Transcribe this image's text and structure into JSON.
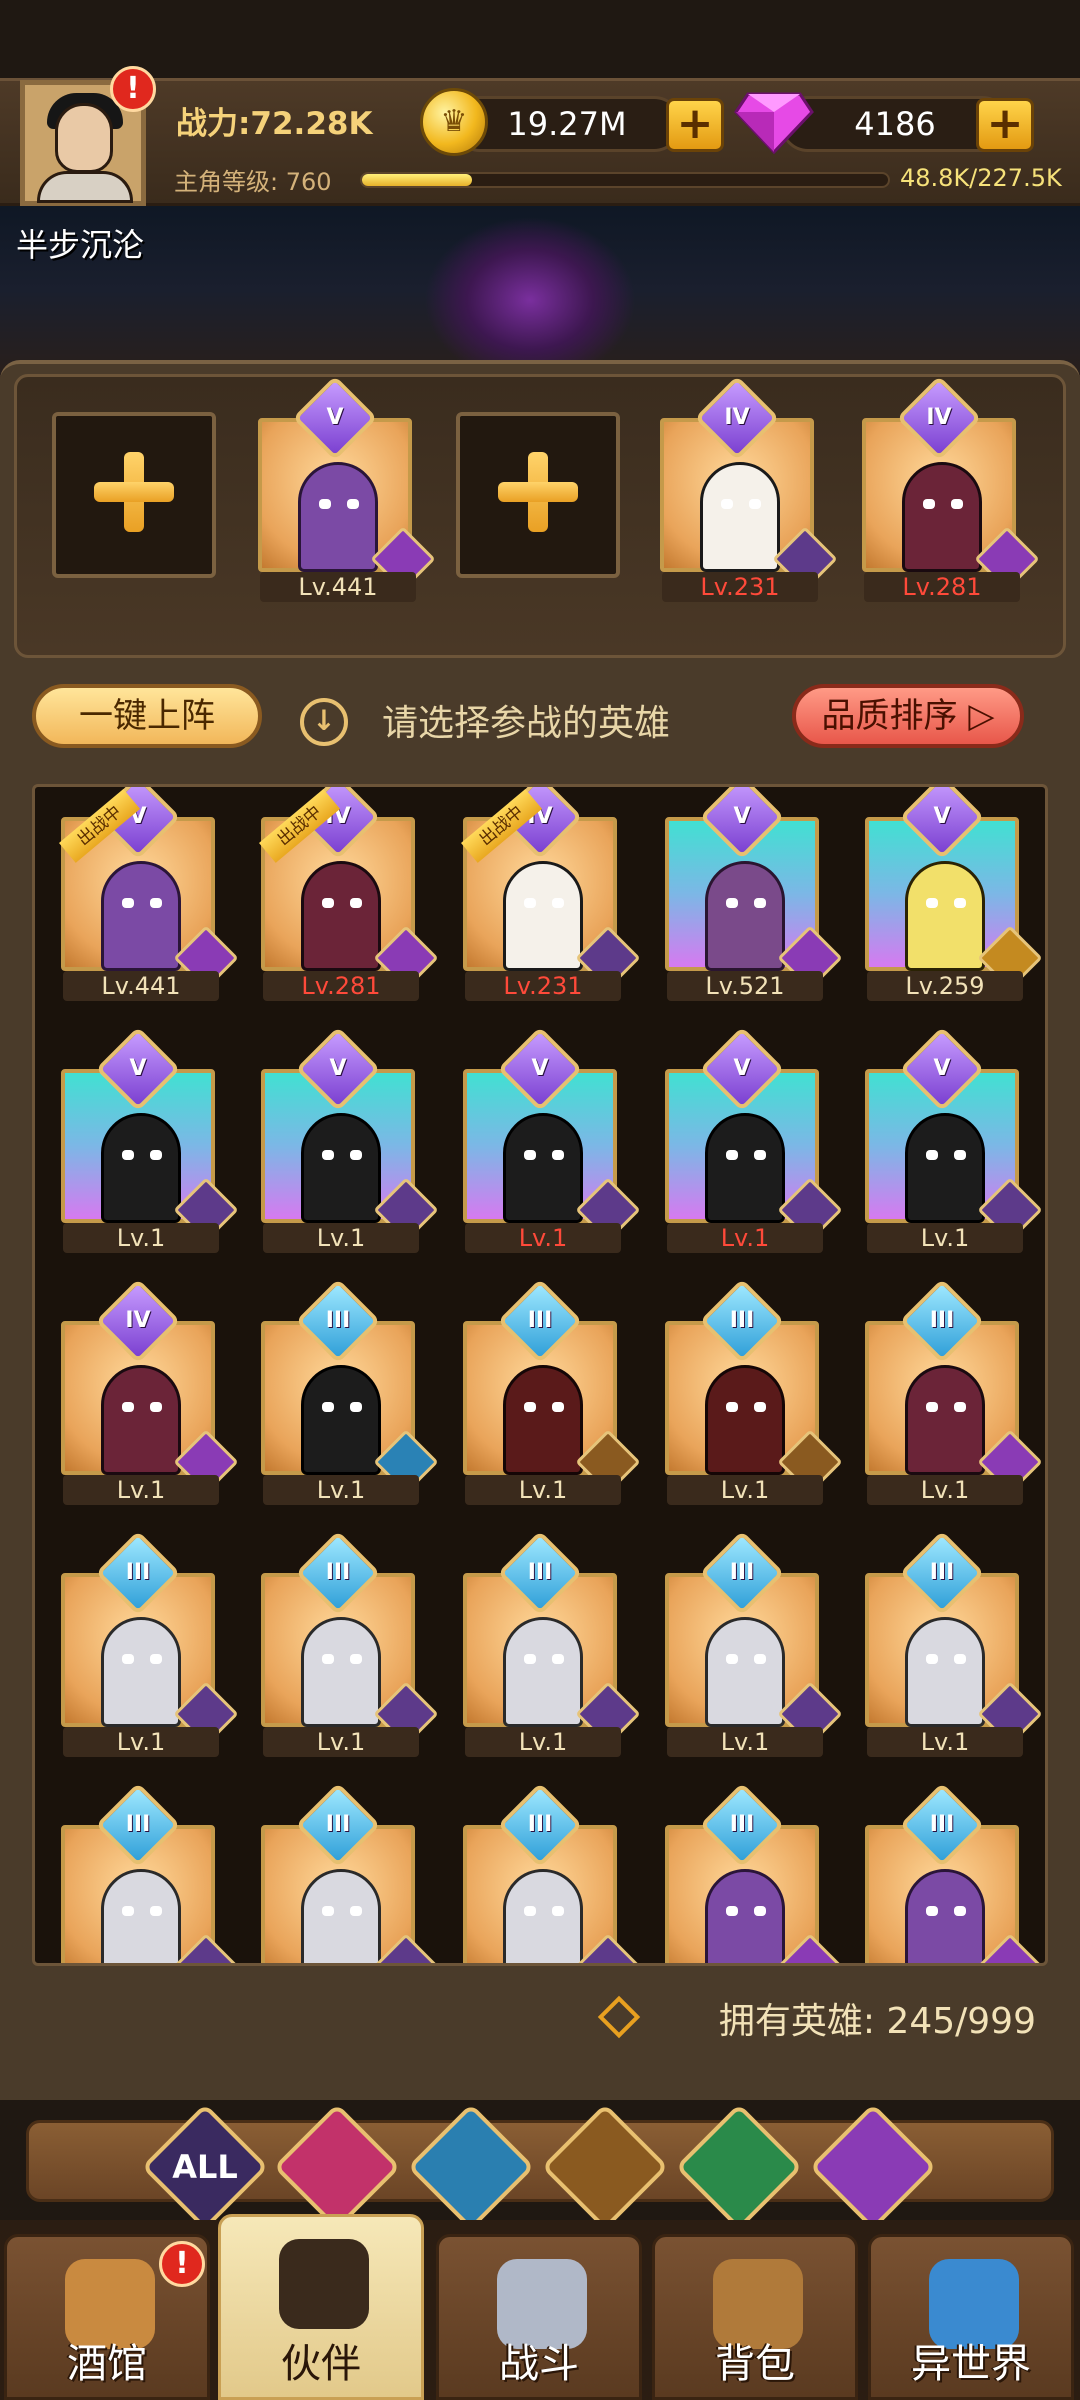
{
  "header": {
    "power_label": "战力:72.28K",
    "gold": "19.27M",
    "gems": "4186",
    "level_label": "主角等级: 760",
    "xp_text": "48.8K/227.5K",
    "xp_fraction": 0.21,
    "player_name": "半步沉沦",
    "alert": "!",
    "coin_glyph": "♛",
    "plus": "+"
  },
  "team": [
    {
      "empty": true
    },
    {
      "rank": "V",
      "portrait": "demon",
      "faction": "demon",
      "level": "Lv.441",
      "level_red": false
    },
    {
      "empty": true
    },
    {
      "rank": "IV",
      "portrait": "priest",
      "faction": "human",
      "level": "Lv.231",
      "level_red": true
    },
    {
      "rank": "IV",
      "portrait": "dark",
      "faction": "demon",
      "level": "Lv.281",
      "level_red": true
    }
  ],
  "actions": {
    "auto_deploy": "一键上阵",
    "hint_icon": "↓",
    "hint": "请选择参战的英雄",
    "sort": "品质排序 ▷"
  },
  "deployed_ribbon": "出战中",
  "heroes": [
    {
      "rank": "V",
      "bg": "gold",
      "portrait": "demon",
      "faction": "demon",
      "level": "Lv.441",
      "red": false,
      "deployed": true
    },
    {
      "rank": "IV",
      "bg": "gold",
      "portrait": "dark",
      "faction": "demon",
      "level": "Lv.281",
      "red": true,
      "deployed": true
    },
    {
      "rank": "IV",
      "bg": "gold",
      "portrait": "priest",
      "faction": "human",
      "level": "Lv.231",
      "red": true,
      "deployed": true
    },
    {
      "rank": "V",
      "bg": "cyan",
      "portrait": "tree",
      "faction": "demon",
      "level": "Lv.521",
      "red": false,
      "deployed": false
    },
    {
      "rank": "V",
      "bg": "cyan",
      "portrait": "gold2",
      "faction": "elf",
      "level": "Lv.259",
      "red": false,
      "deployed": false
    },
    {
      "rank": "V",
      "bg": "cyan",
      "portrait": "shadow",
      "faction": "human",
      "level": "Lv.1",
      "red": false,
      "deployed": false
    },
    {
      "rank": "V",
      "bg": "cyan",
      "portrait": "shadow",
      "faction": "human",
      "level": "Lv.1",
      "red": false,
      "deployed": false
    },
    {
      "rank": "V",
      "bg": "cyan",
      "portrait": "shadow",
      "faction": "human",
      "level": "Lv.1",
      "red": true,
      "deployed": false
    },
    {
      "rank": "V",
      "bg": "cyan",
      "portrait": "shadow",
      "faction": "human",
      "level": "Lv.1",
      "red": true,
      "deployed": false
    },
    {
      "rank": "V",
      "bg": "cyan",
      "portrait": "shadow",
      "faction": "human",
      "level": "Lv.1",
      "red": false,
      "deployed": false
    },
    {
      "rank": "IV",
      "bg": "gold",
      "portrait": "dark",
      "faction": "demon",
      "level": "Lv.1",
      "red": false,
      "deployed": false
    },
    {
      "rank": "III",
      "bg": "gold",
      "portrait": "shadow",
      "faction": "sea",
      "level": "Lv.1",
      "red": false,
      "deployed": false
    },
    {
      "rank": "III",
      "bg": "gold",
      "portrait": "red",
      "faction": "beast",
      "level": "Lv.1",
      "red": false,
      "deployed": false
    },
    {
      "rank": "III",
      "bg": "gold",
      "portrait": "red",
      "faction": "beast",
      "level": "Lv.1",
      "red": false,
      "deployed": false
    },
    {
      "rank": "III",
      "bg": "gold",
      "portrait": "dark",
      "faction": "demon",
      "level": "Lv.1",
      "red": false,
      "deployed": false
    },
    {
      "rank": "III",
      "bg": "gold",
      "portrait": "knight",
      "faction": "human",
      "level": "Lv.1",
      "red": false,
      "deployed": false
    },
    {
      "rank": "III",
      "bg": "gold",
      "portrait": "knight",
      "faction": "human",
      "level": "Lv.1",
      "red": false,
      "deployed": false
    },
    {
      "rank": "III",
      "bg": "gold",
      "portrait": "knight",
      "faction": "human",
      "level": "Lv.1",
      "red": false,
      "deployed": false
    },
    {
      "rank": "III",
      "bg": "gold",
      "portrait": "knight",
      "faction": "human",
      "level": "Lv.1",
      "red": false,
      "deployed": false
    },
    {
      "rank": "III",
      "bg": "gold",
      "portrait": "knight",
      "faction": "human",
      "level": "Lv.1",
      "red": false,
      "deployed": false
    },
    {
      "rank": "III",
      "bg": "gold",
      "portrait": "knight",
      "faction": "human",
      "level": "",
      "red": false,
      "deployed": false
    },
    {
      "rank": "III",
      "bg": "gold",
      "portrait": "knight",
      "faction": "human",
      "level": "",
      "red": false,
      "deployed": false
    },
    {
      "rank": "III",
      "bg": "gold",
      "portrait": "knight",
      "faction": "human",
      "level": "",
      "red": false,
      "deployed": false
    },
    {
      "rank": "III",
      "bg": "gold",
      "portrait": "demon",
      "faction": "demon",
      "level": "",
      "red": false,
      "deployed": false
    },
    {
      "rank": "III",
      "bg": "gold",
      "portrait": "demon",
      "faction": "demon",
      "level": "",
      "red": false,
      "deployed": false
    }
  ],
  "owned_label": "拥有英雄: 245/999",
  "filters": [
    {
      "label": "ALL",
      "color": "#3a2a60",
      "name": "all"
    },
    {
      "label": "",
      "color": "#c2326a",
      "name": "human"
    },
    {
      "label": "",
      "color": "#2a7fb0",
      "name": "sea"
    },
    {
      "label": "",
      "color": "#8a5a20",
      "name": "beast"
    },
    {
      "label": "",
      "color": "#2a8a4a",
      "name": "elf"
    },
    {
      "label": "",
      "color": "#8a3bb5",
      "name": "demon"
    }
  ],
  "nav": [
    {
      "label": "酒馆",
      "icon": "tavern-icon",
      "color": "#c98a40",
      "alert": true,
      "active": false
    },
    {
      "label": "伙伴",
      "icon": "partner-icon",
      "color": "#3a2a1c",
      "alert": false,
      "active": true
    },
    {
      "label": "战斗",
      "icon": "battle-icon",
      "color": "#b0b8c8",
      "alert": false,
      "active": false
    },
    {
      "label": "背包",
      "icon": "backpack-icon",
      "color": "#b07a3a",
      "alert": false,
      "active": false
    },
    {
      "label": "异世界",
      "icon": "portal-icon",
      "color": "#3a8ad0",
      "alert": false,
      "active": false
    }
  ]
}
